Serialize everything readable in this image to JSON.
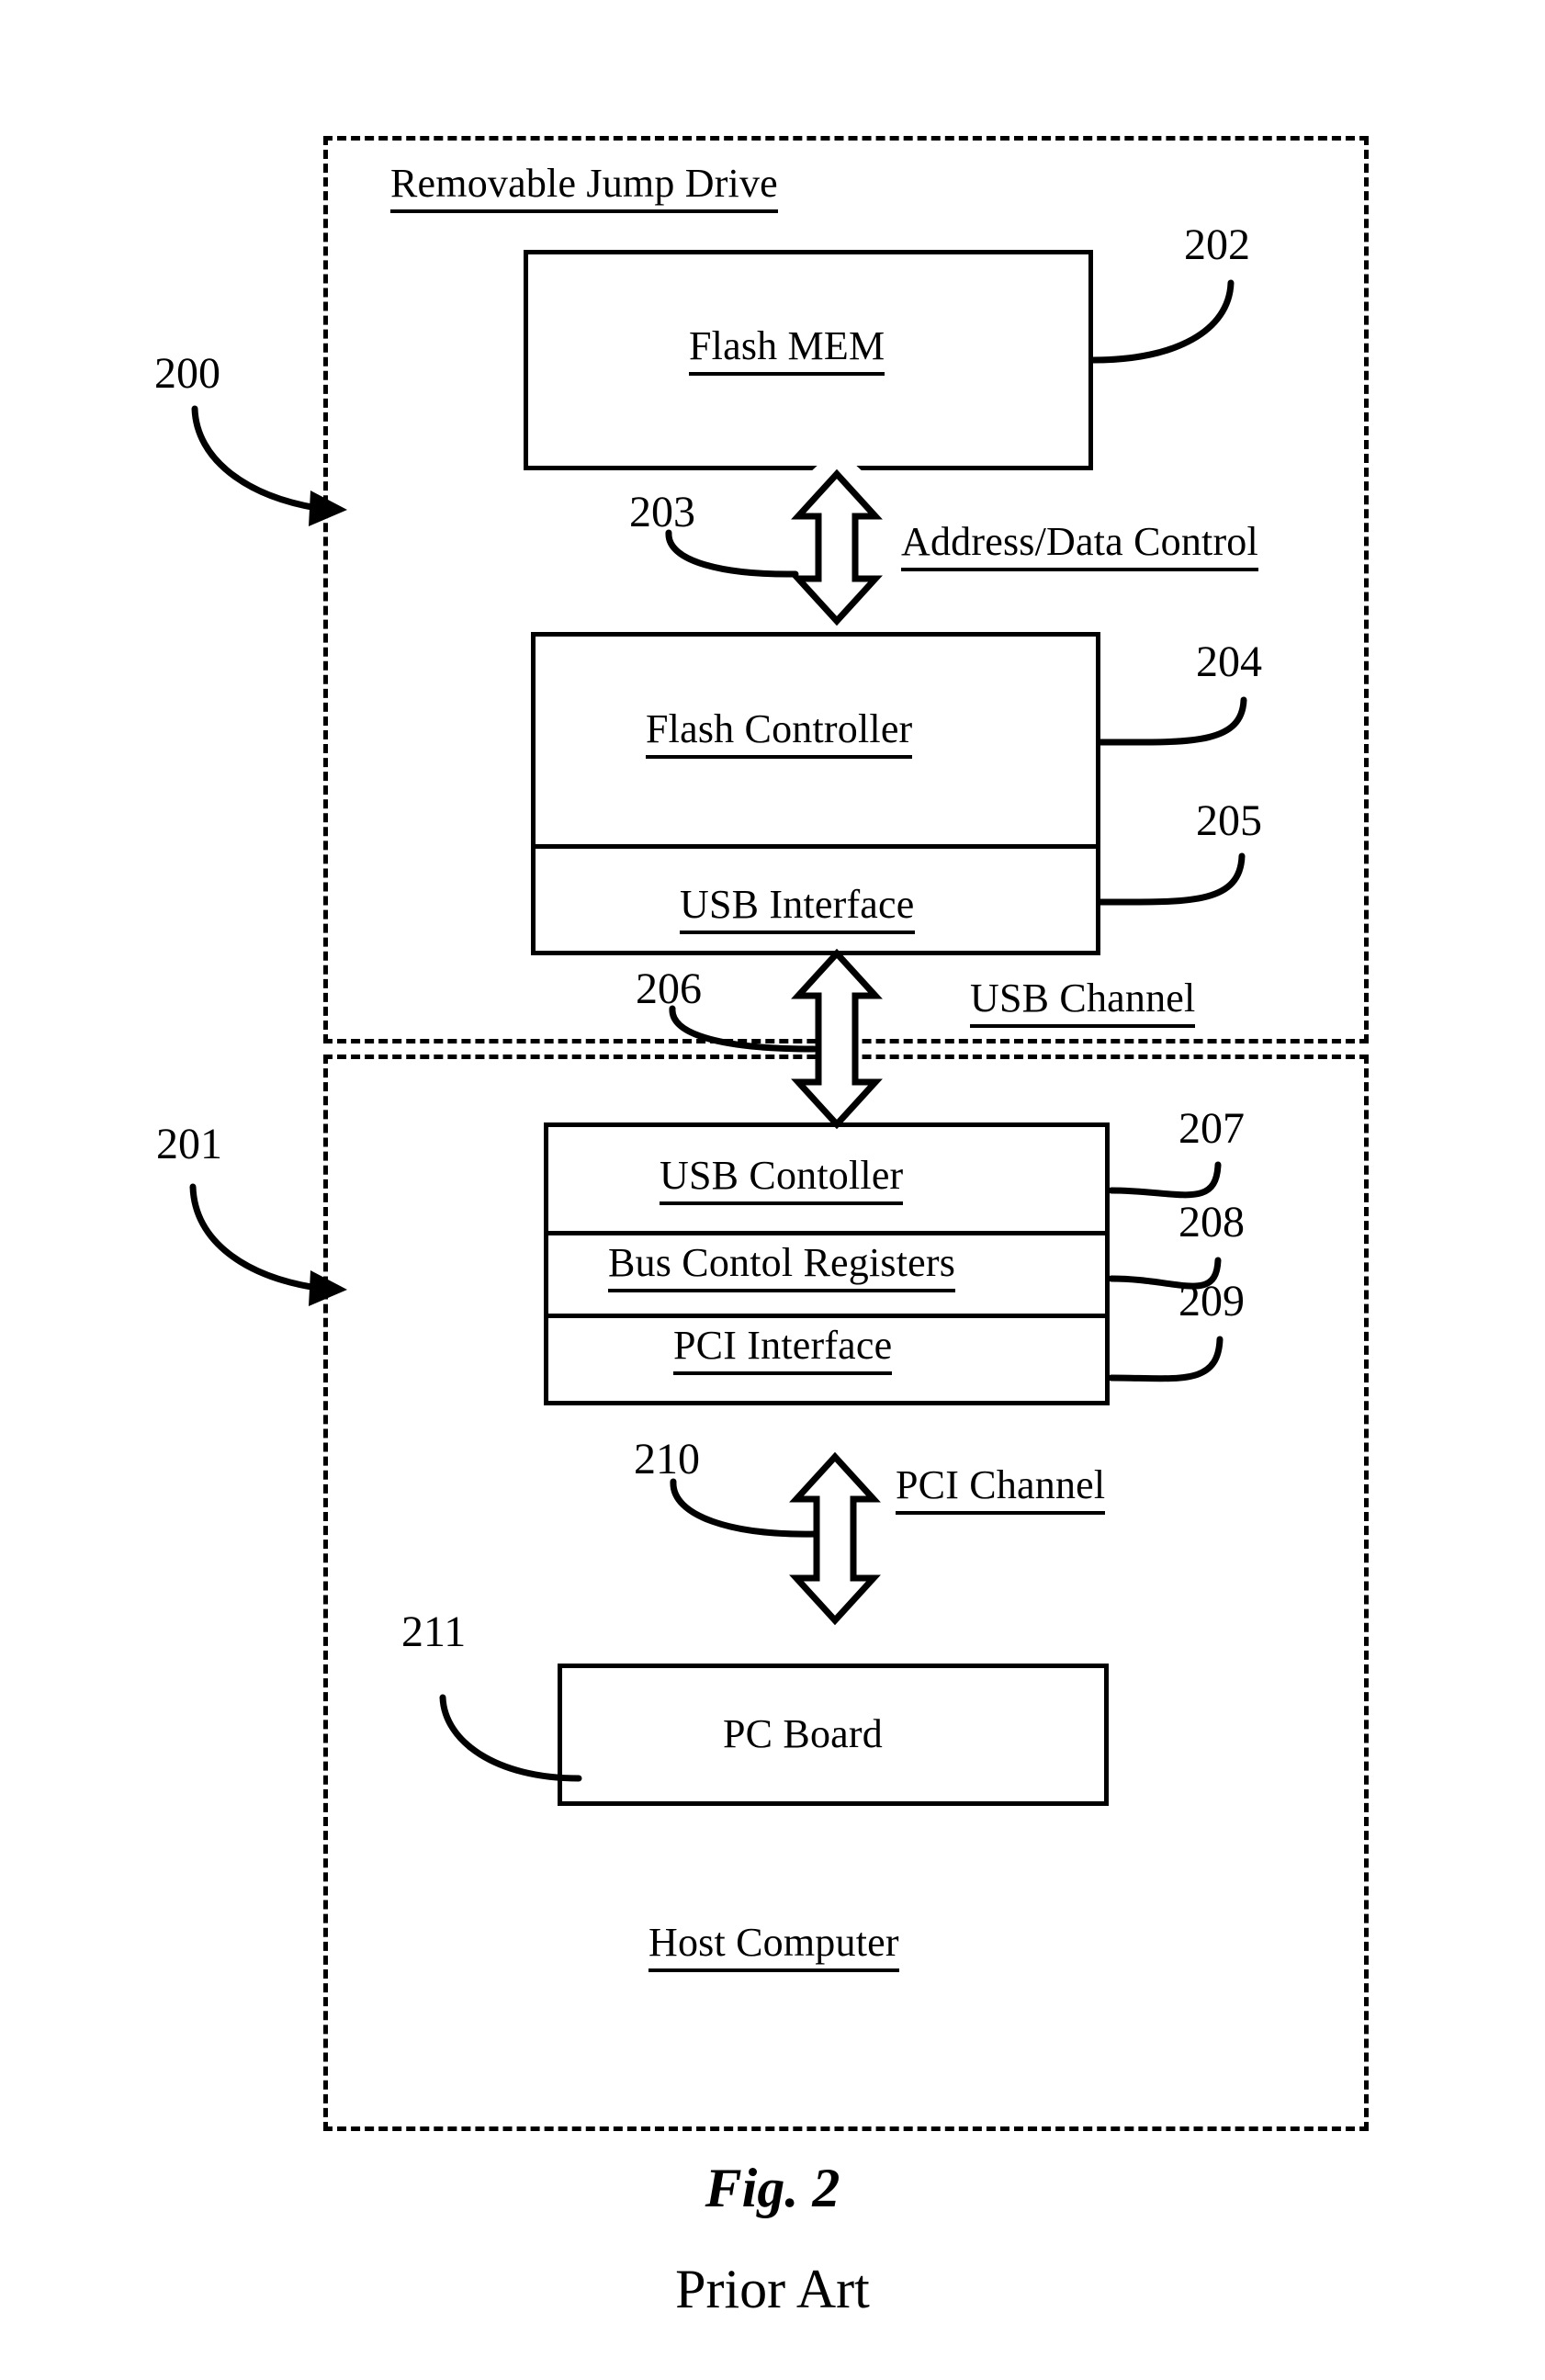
{
  "figure": {
    "caption": "Fig. 2",
    "subcaption": "Prior Art",
    "line_color": "#000000",
    "background_color": "#ffffff"
  },
  "enclosures": [
    {
      "id": "removable-jump-drive",
      "title": "Removable Jump Drive",
      "ref": "200"
    },
    {
      "id": "host-computer",
      "title": "Host Computer",
      "ref": "201"
    }
  ],
  "blocks": [
    {
      "id": "flash-mem",
      "label": "Flash MEM",
      "ref": "202",
      "underlined": true
    },
    {
      "id": "flash-controller",
      "label": "Flash Controller",
      "ref": "204",
      "underlined": true
    },
    {
      "id": "usb-interface",
      "label": "USB Interface",
      "ref": "205",
      "underlined": true
    },
    {
      "id": "usb-controller",
      "label": "USB Contoller",
      "ref": "207",
      "underlined": true
    },
    {
      "id": "bus-control-registers",
      "label": "Bus Contol Registers",
      "ref": "208",
      "underlined": true
    },
    {
      "id": "pci-interface",
      "label": "PCI Interface",
      "ref": "209",
      "underlined": true
    },
    {
      "id": "pc-board",
      "label": "PC Board",
      "ref": "211",
      "underlined": false
    }
  ],
  "connections": [
    {
      "id": "address-data-control",
      "label": "Address/Data Control",
      "ref": "203",
      "type": "double-arrow"
    },
    {
      "id": "usb-channel",
      "label": "USB Channel",
      "ref": "206",
      "type": "double-arrow"
    },
    {
      "id": "pci-channel",
      "label": "PCI Channel",
      "ref": "210",
      "type": "double-arrow"
    }
  ],
  "refs": {
    "r200": "200",
    "r201": "201",
    "r202": "202",
    "r203": "203",
    "r204": "204",
    "r205": "205",
    "r206": "206",
    "r207": "207",
    "r208": "208",
    "r209": "209",
    "r210": "210",
    "r211": "211"
  }
}
